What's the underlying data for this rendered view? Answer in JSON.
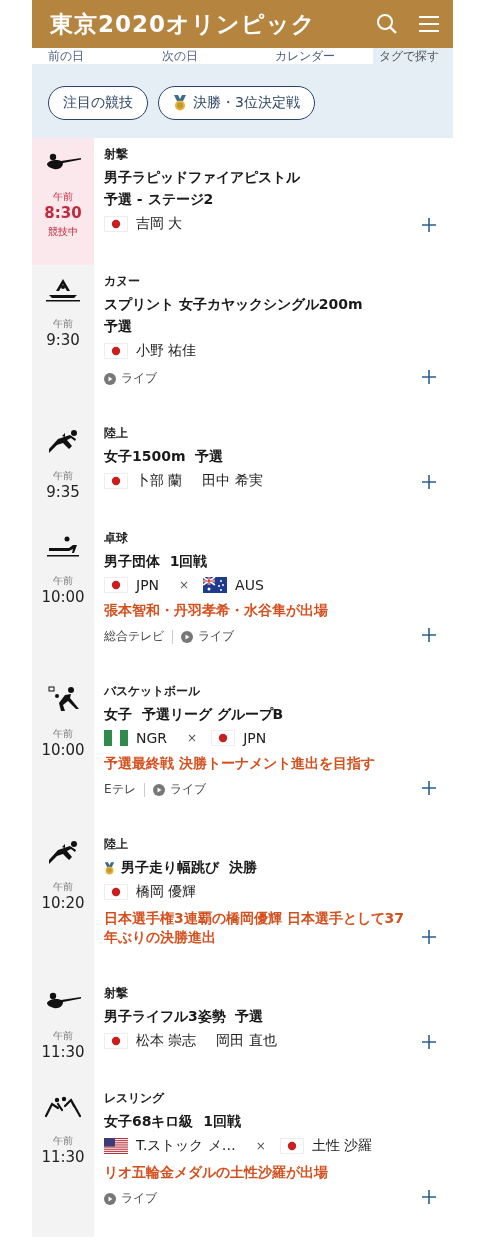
{
  "header": {
    "logo": "東京2020オリンピック"
  },
  "nav": [
    {
      "label": "前の日",
      "selected": false
    },
    {
      "label": "次の日",
      "selected": false
    },
    {
      "label": "カレンダー",
      "selected": false
    },
    {
      "label": "タグで探す",
      "selected": true
    }
  ],
  "filters": [
    {
      "label": "注目の競技",
      "medal": false
    },
    {
      "label": "決勝・3位決定戦",
      "medal": true
    }
  ],
  "events": [
    {
      "sport": "射撃",
      "kind": "shooting",
      "period": "午前",
      "time": "8:30",
      "active": true,
      "status": "競技中",
      "title_lines": [
        "男子ラピッドファイアピストル",
        "予選 - ステージ2"
      ],
      "participants": [
        {
          "kind": "jp",
          "names": [
            "吉岡 大"
          ]
        }
      ]
    },
    {
      "sport": "カヌー",
      "kind": "canoe",
      "period": "午前",
      "time": "9:30",
      "active": false,
      "title_lines": [
        "スプリント 女子カヤックシングル200m",
        "予選"
      ],
      "participants": [
        {
          "kind": "jp",
          "names": [
            "小野 祐佳"
          ]
        }
      ],
      "meta": [
        {
          "kind": "live",
          "label": "ライブ"
        }
      ]
    },
    {
      "sport": "陸上",
      "kind": "athletics",
      "period": "午前",
      "time": "9:35",
      "active": false,
      "title_lines": [
        "女子1500m  予選"
      ],
      "participants": [
        {
          "kind": "jp",
          "names": [
            "卜部 蘭",
            "田中 希実"
          ]
        }
      ]
    },
    {
      "sport": "卓球",
      "kind": "table-tennis",
      "period": "午前",
      "time": "10:00",
      "active": false,
      "title_lines": [
        "男子団体  1回戦"
      ],
      "participants": [
        {
          "kind": "jp",
          "names": [
            "JPN"
          ]
        },
        {
          "kind": "au",
          "names": [
            "AUS"
          ]
        }
      ],
      "versus": "×",
      "note": "張本智和・丹羽孝希・水谷隼が出場",
      "meta": [
        {
          "kind": "channel",
          "label": "総合テレビ"
        },
        {
          "kind": "live",
          "label": "ライブ"
        }
      ]
    },
    {
      "sport": "バスケットボール",
      "kind": "basketball",
      "period": "午前",
      "time": "10:00",
      "active": false,
      "title_lines": [
        "女子  予選リーグ グループB"
      ],
      "participants": [
        {
          "kind": "ng",
          "names": [
            "NGR"
          ]
        },
        {
          "kind": "jp",
          "names": [
            "JPN"
          ]
        }
      ],
      "versus": "×",
      "note": "予選最終戦 決勝トーナメント進出を目指す",
      "meta": [
        {
          "kind": "channel",
          "label": "Eテレ"
        },
        {
          "kind": "live",
          "label": "ライブ"
        }
      ]
    },
    {
      "sport": "陸上",
      "kind": "athletics",
      "period": "午前",
      "time": "10:20",
      "active": false,
      "medal": true,
      "title_lines": [
        "男子走り幅跳び  決勝"
      ],
      "participants": [
        {
          "kind": "jp",
          "names": [
            "橋岡 優輝"
          ]
        }
      ],
      "note": "日本選手権3連覇の橋岡優輝 日本選手として37年ぶりの決勝進出"
    },
    {
      "sport": "射撃",
      "kind": "shooting",
      "period": "午前",
      "time": "11:30",
      "active": false,
      "title_lines": [
        "男子ライフル3姿勢  予選"
      ],
      "participants": [
        {
          "kind": "jp",
          "names": [
            "松本 崇志",
            "岡田 直也"
          ]
        }
      ]
    },
    {
      "sport": "レスリング",
      "kind": "wrestling",
      "period": "午前",
      "time": "11:30",
      "active": false,
      "title_lines": [
        "女子68キロ級  1回戦"
      ],
      "participants": [
        {
          "kind": "us",
          "names": [
            "T.ストック メ…"
          ]
        },
        {
          "kind": "jp",
          "names": [
            "土性 沙羅"
          ]
        }
      ],
      "versus": "×",
      "note": "リオ五輪金メダルの土性沙羅が出場",
      "meta": [
        {
          "kind": "live",
          "label": "ライブ"
        }
      ]
    }
  ]
}
